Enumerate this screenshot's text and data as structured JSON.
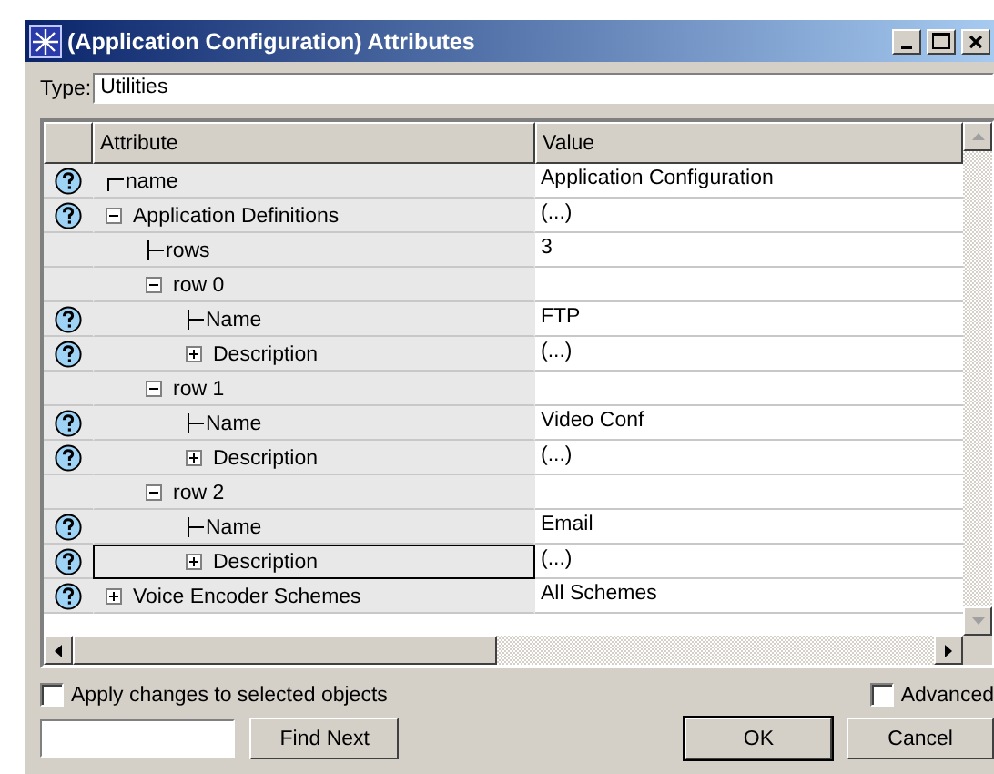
{
  "window": {
    "title": "(Application Configuration) Attributes"
  },
  "type_field": {
    "label": "Type:",
    "value": "Utilities"
  },
  "table": {
    "columns": [
      "Attribute",
      "Value"
    ],
    "rows": [
      {
        "label": "name",
        "value": "Application Configuration",
        "help": true,
        "selected": false
      },
      {
        "label": "Application Definitions",
        "value": "(...)",
        "help": true,
        "selected": false,
        "expanded": true,
        "children": [
          {
            "label": "rows",
            "value": "3",
            "help": false,
            "selected": false
          },
          {
            "label": "row 0",
            "help": false,
            "selected": false,
            "expanded": true,
            "children": [
              {
                "label": "Name",
                "value": "FTP",
                "help": true,
                "selected": false
              },
              {
                "label": "Description",
                "value": "(...)",
                "help": true,
                "selected": false,
                "expanded": false
              }
            ]
          },
          {
            "label": "row 1",
            "help": false,
            "selected": false,
            "expanded": true,
            "children": [
              {
                "label": "Name",
                "value": "Video Conf",
                "help": true,
                "selected": false
              },
              {
                "label": "Description",
                "value": "(...)",
                "help": true,
                "selected": false,
                "expanded": false
              }
            ]
          },
          {
            "label": "row 2",
            "help": false,
            "selected": false,
            "expanded": true,
            "children": [
              {
                "label": "Name",
                "value": "Email",
                "help": true,
                "selected": false
              },
              {
                "label": "Description",
                "value": "(...)",
                "help": true,
                "selected": true,
                "expanded": false
              }
            ]
          }
        ]
      },
      {
        "label": "Voice Encoder Schemes",
        "value": "All Schemes",
        "help": true,
        "selected": false,
        "expanded": false
      }
    ]
  },
  "options": [
    {
      "label": "Apply changes to selected objects",
      "checked": false
    },
    {
      "label": "Advanced",
      "checked": false
    }
  ],
  "buttons": [
    "Find Next",
    "OK",
    "Cancel"
  ]
}
